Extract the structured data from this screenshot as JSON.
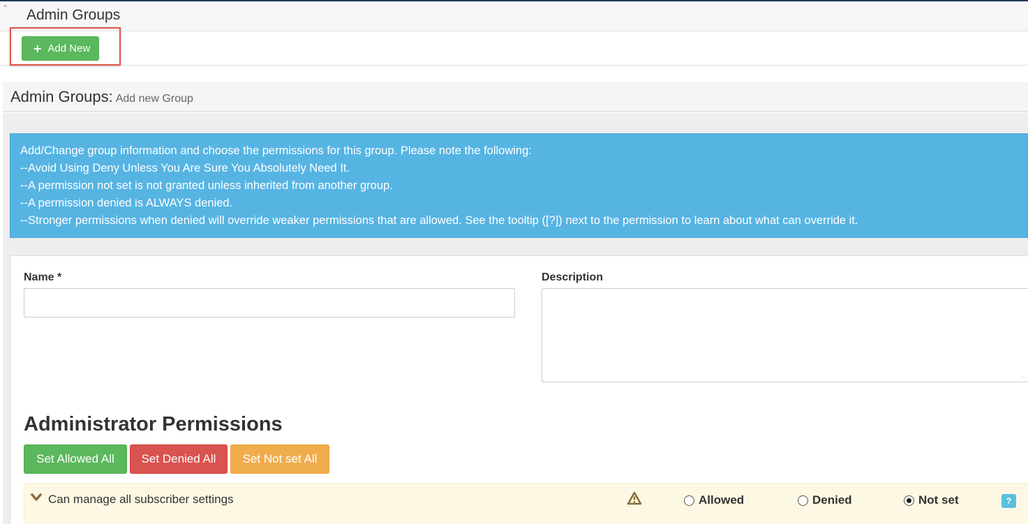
{
  "top": {
    "title": "Admin Groups",
    "add_new_label": "Add New"
  },
  "section": {
    "title": "Admin Groups:",
    "subtitle": "Add new Group"
  },
  "info": {
    "lines": [
      "Add/Change group information and choose the permissions for this group. Please note the following:",
      "--Avoid Using Deny Unless You Are Sure You Absolutely Need It.",
      "--A permission not set is not granted unless inherited from another group.",
      "--A permission denied is ALWAYS denied.",
      "--Stronger permissions when denied will override weaker permissions that are allowed. See the tooltip ([?]) next to the permission to learn about what can override it."
    ]
  },
  "form": {
    "name_label": "Name *",
    "name_value": "",
    "description_label": "Description",
    "description_value": ""
  },
  "permissions": {
    "title": "Administrator Permissions",
    "set_allowed_all": "Set Allowed All",
    "set_denied_all": "Set Denied All",
    "set_not_set_all": "Set Not set All",
    "rows": [
      {
        "label": "Can manage all subscriber settings",
        "options": [
          "Allowed",
          "Denied",
          "Not set"
        ],
        "selected": "Not set",
        "help": "?"
      }
    ]
  },
  "colors": {
    "success": "#5cb85c",
    "danger": "#d9534f",
    "warning": "#f0ad4e",
    "info": "#56b4e3",
    "row_highlight": "#fcf8e3",
    "callout_border": "#e0534a"
  }
}
